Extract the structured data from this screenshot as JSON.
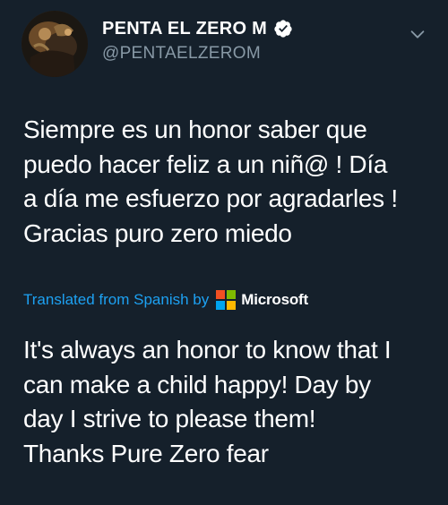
{
  "tweet": {
    "author": {
      "display_name": "PENTA EL ZERO M",
      "handle": "@PENTAELZEROM",
      "verified": true
    },
    "text": "Siempre es un honor saber que\npuedo hacer feliz a un niñ@ ! Día\na día me esfuerzo por agradarles !\nGracias puro zero miedo",
    "translation": {
      "label": "Translated from Spanish by",
      "provider": "Microsoft",
      "text": "It's always an honor to know that I\ncan make a child happy! Day by\nday I strive to please them!\nThanks Pure Zero fear"
    }
  },
  "icons": {
    "verified": "verified-badge-icon",
    "caret": "chevron-down-icon",
    "provider_logo": "microsoft-logo-icon"
  },
  "colors": {
    "background": "#15202b",
    "text": "#ffffff",
    "secondary_text": "#8899a6",
    "link": "#1da1f2",
    "ms_red": "#f25022",
    "ms_green": "#7fba00",
    "ms_blue": "#00a4ef",
    "ms_yellow": "#ffb900"
  }
}
